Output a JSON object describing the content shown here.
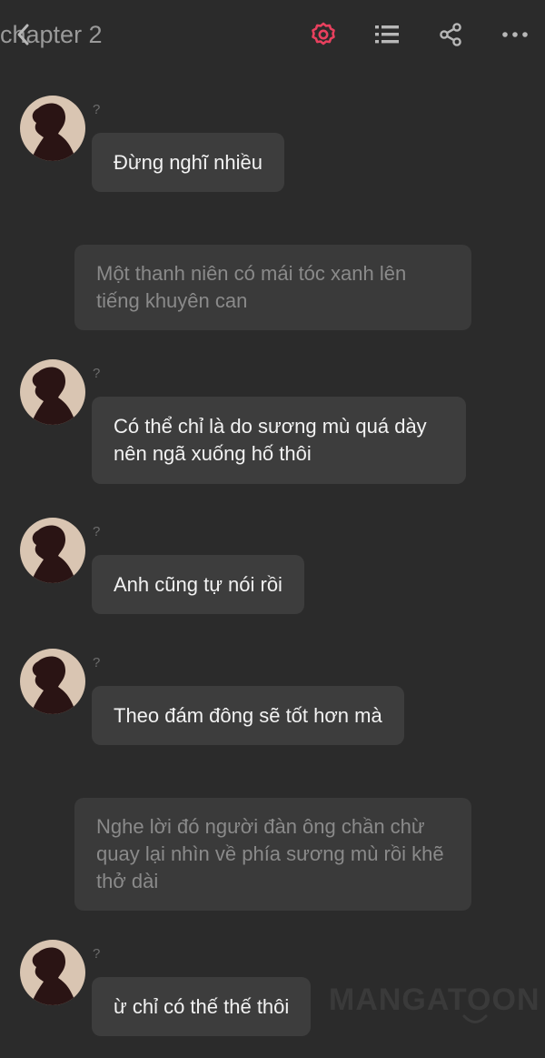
{
  "header": {
    "title": "chapter 2",
    "icons": [
      "back-arrow-icon",
      "gear-icon",
      "list-icon",
      "share-icon",
      "more-icon"
    ],
    "accent_color": "#e8405e"
  },
  "messages": [
    {
      "type": "character",
      "name": "?",
      "text": "Đừng nghĩ nhiều"
    },
    {
      "type": "narration",
      "text": "Một thanh niên có mái tóc xanh lên tiếng khuyên can"
    },
    {
      "type": "character",
      "name": "?",
      "text": "Có thể chỉ là do sương mù quá dày nên ngã xuống hố thôi"
    },
    {
      "type": "character",
      "name": "?",
      "text": "Anh cũng tự nói rồi"
    },
    {
      "type": "character",
      "name": "?",
      "text": "Theo đám đông sẽ tốt hơn mà"
    },
    {
      "type": "narration",
      "text": "Nghe lời đó người đàn ông chần chừ quay lại nhìn về phía sương mù rồi khẽ thở dài"
    },
    {
      "type": "character",
      "name": "?",
      "text": "ừ chỉ có thế thế thôi"
    }
  ],
  "watermark": "MANGATOON"
}
